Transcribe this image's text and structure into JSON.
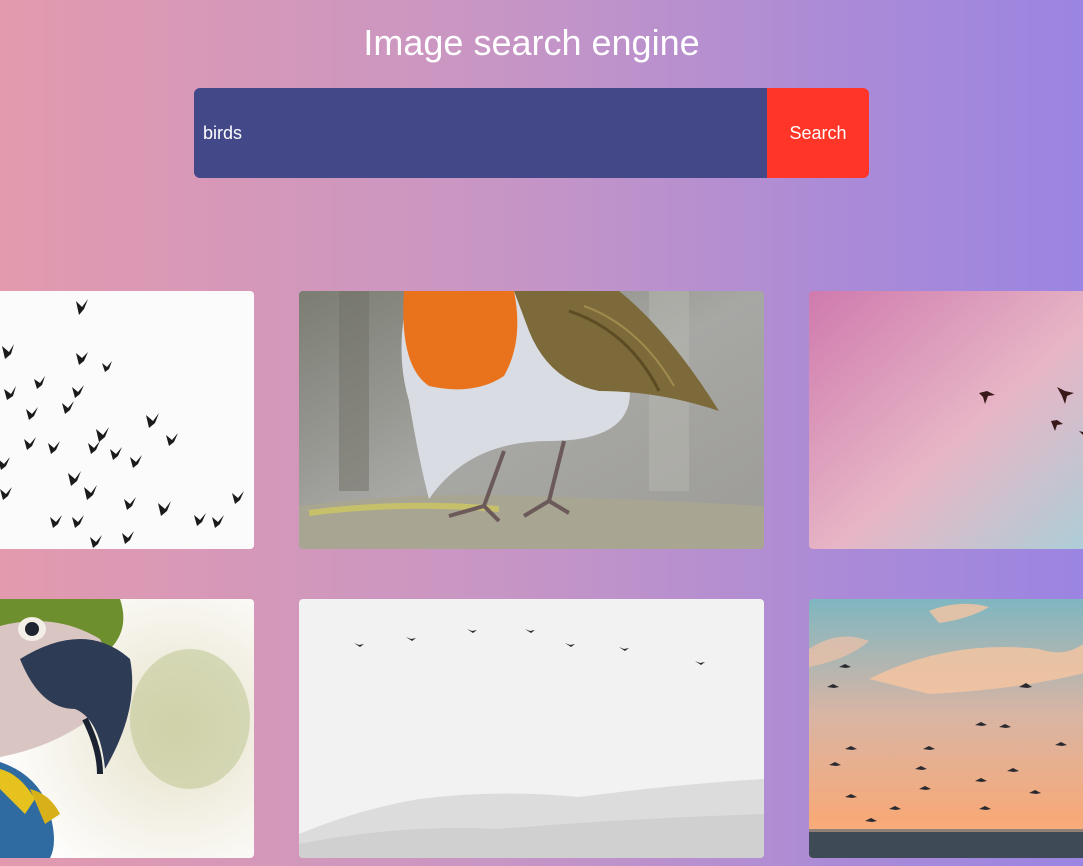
{
  "header": {
    "title": "Image search engine"
  },
  "search": {
    "value": "birds",
    "button_label": "Search"
  },
  "results": [
    {
      "subject": "flock-silhouettes"
    },
    {
      "subject": "robin-on-branch"
    },
    {
      "subject": "birds-pink-sky"
    },
    {
      "subject": "macaw-portrait"
    },
    {
      "subject": "birds-misty-mountains"
    },
    {
      "subject": "birds-sunset-sea"
    }
  ],
  "colors": {
    "input_bg": "#434889",
    "button_bg": "#ff3527",
    "gradient_start": "#e39aae",
    "gradient_end": "#9b85e2"
  }
}
